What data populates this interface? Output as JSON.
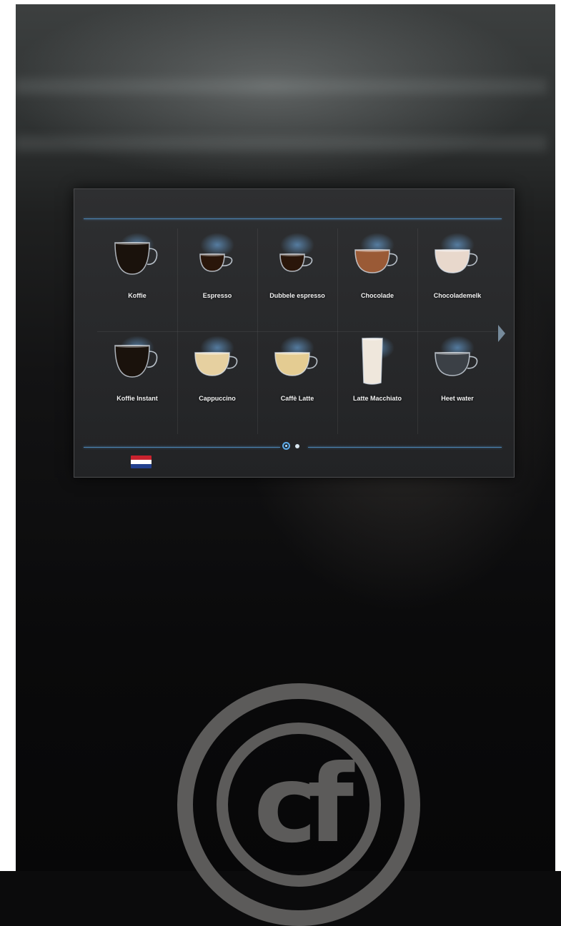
{
  "menu": {
    "items": [
      {
        "label": "Koffie",
        "icon": "coffee-cup-icon",
        "liquid": "#1a120c"
      },
      {
        "label": "Espresso",
        "icon": "espresso-cup-icon",
        "liquid": "#2a160a"
      },
      {
        "label": "Dubbele espresso",
        "icon": "double-espresso-cup-icon",
        "liquid": "#2a160a"
      },
      {
        "label": "Chocolade",
        "icon": "chocolate-cup-icon",
        "liquid": "#9a5a36"
      },
      {
        "label": "Chocolademelk",
        "icon": "chocolate-milk-cup-icon",
        "liquid": "#e8d8cc"
      },
      {
        "label": "Koffie Instant",
        "icon": "instant-coffee-cup-icon",
        "liquid": "#1a120c"
      },
      {
        "label": "Cappuccino",
        "icon": "cappuccino-cup-icon",
        "liquid": "#e6d0a0"
      },
      {
        "label": "Caffè Latte",
        "icon": "caffe-latte-cup-icon",
        "liquid": "#e4cc92"
      },
      {
        "label": "Latte Macchiato",
        "icon": "latte-macchiato-glass-icon",
        "liquid": "#efe7dc"
      },
      {
        "label": "Heet water",
        "icon": "hot-water-cup-icon",
        "liquid": "#3b4046"
      }
    ]
  },
  "pagination": {
    "current": 1,
    "total": 2
  },
  "language": {
    "icon": "dutch-flag-icon",
    "colors": [
      "#c8222e",
      "#ffffff",
      "#23408e"
    ]
  },
  "logo": {
    "text": "cf"
  }
}
